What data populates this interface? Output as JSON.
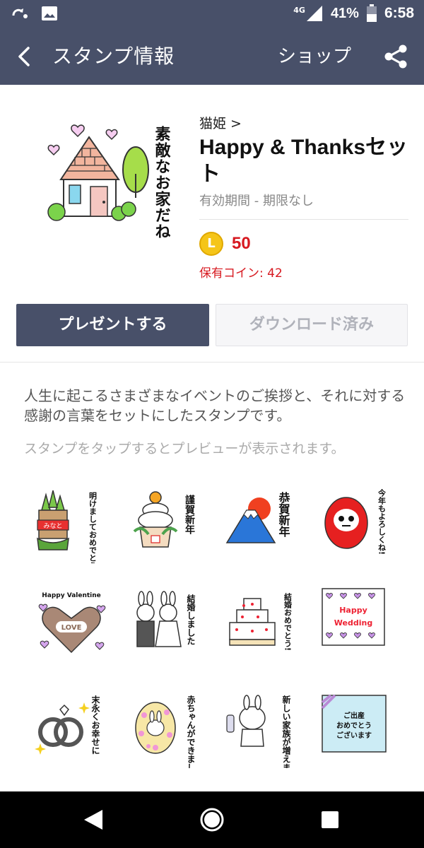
{
  "status_bar": {
    "network": "4G",
    "battery": "41%",
    "time": "6:58",
    "icons": [
      "sync-icon",
      "image-icon",
      "signal-icon",
      "battery-icon"
    ]
  },
  "app_bar": {
    "title": "スタンプ情報",
    "shop_label": "ショップ",
    "back_icon": "back-arrow-icon",
    "share_icon": "share-icon"
  },
  "sticker": {
    "hero_caption": "素敵なお家だね",
    "author": "猫姫 >",
    "name": "Happy & Thanksセット",
    "validity": "有効期間 - 期限なし",
    "coin_letter": "L",
    "price": "50",
    "owned_coins": "保有コイン: 42"
  },
  "buttons": {
    "present": "プレゼントする",
    "downloaded": "ダウンロード済み"
  },
  "description": "人生に起こるさまざまなイベントのご挨拶と、それに対する感謝の言葉をセットにしたスタンプです。",
  "preview_hint": "スタンプをタップするとプレビューが表示されます。",
  "stickers": [
    {
      "name": "kadomatsu-sticker",
      "text": "明けましておめでとうございます",
      "badge": "みなと"
    },
    {
      "name": "kagamimochi-sticker",
      "text": "謹賀新年"
    },
    {
      "name": "mount-fuji-sticker",
      "text": "恭賀新年"
    },
    {
      "name": "daruma-sticker",
      "text": "今年もよろしくね!"
    },
    {
      "name": "valentine-sticker",
      "text": "Happy Valentine",
      "badge": "LOVE"
    },
    {
      "name": "bride-groom-sticker",
      "text": "結婚しました"
    },
    {
      "name": "wedding-cake-sticker",
      "text": "結婚おめでとう!"
    },
    {
      "name": "happy-wedding-sticker",
      "text": "Happy",
      "text2": "Wedding"
    },
    {
      "name": "rings-sticker",
      "text": "末永くお幸せに"
    },
    {
      "name": "baby-egg-sticker",
      "text": "赤ちゃんができました"
    },
    {
      "name": "new-family-sticker",
      "text": "新しい家族が増えました"
    },
    {
      "name": "birth-gift-sticker",
      "text": "ご出産おめでとうございます"
    }
  ],
  "colors": {
    "header": "#485069",
    "price_red": "#d71920",
    "coin": "#f5c518"
  },
  "nav_bar": {
    "icons": [
      "back-triangle-icon",
      "home-circle-icon",
      "recents-square-icon"
    ]
  }
}
